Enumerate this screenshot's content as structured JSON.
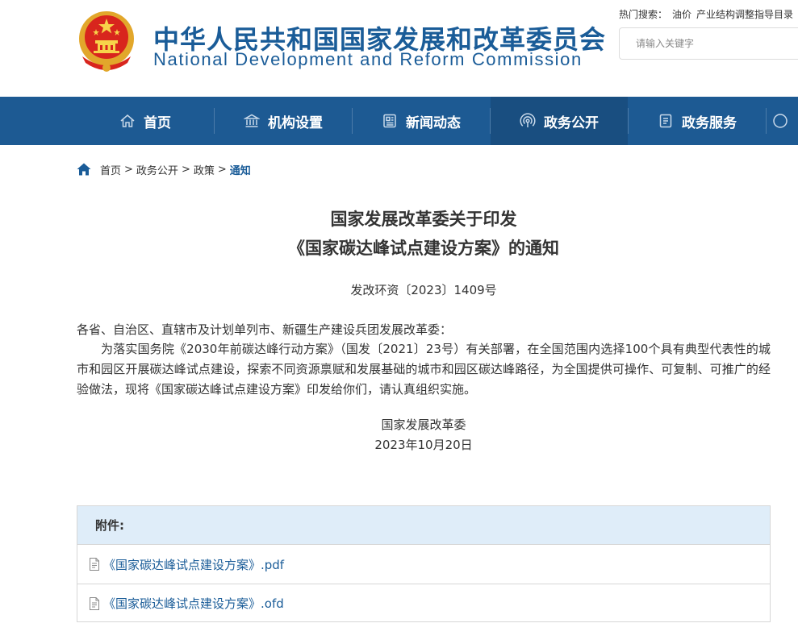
{
  "header": {
    "title_cn": "中华人民共和国国家发展和改革委员会",
    "title_en": "National Development and Reform Commission",
    "hot_search_label": "热门搜索：",
    "hot_search_items": [
      "油价",
      "产业结构调整指导目录"
    ],
    "search_placeholder": "请输入关键字"
  },
  "nav": {
    "items": [
      {
        "label": "首页",
        "icon": "home-icon"
      },
      {
        "label": "机构设置",
        "icon": "institution-icon"
      },
      {
        "label": "新闻动态",
        "icon": "news-icon"
      },
      {
        "label": "政务公开",
        "icon": "broadcast-icon",
        "active": true
      },
      {
        "label": "政务服务",
        "icon": "document-icon"
      }
    ]
  },
  "breadcrumb": {
    "items": [
      "首页",
      "政务公开",
      "政策",
      "通知"
    ],
    "separator": ">"
  },
  "article": {
    "title_line1": "国家发展改革委关于印发",
    "title_line2": "《国家碳达峰试点建设方案》的通知",
    "doc_number": "发改环资〔2023〕1409号",
    "addressee": "各省、自治区、直辖市及计划单列市、新疆生产建设兵团发展改革委：",
    "body": "为落实国务院《2030年前碳达峰行动方案》（国发〔2021〕23号）有关部署，在全国范围内选择100个具有典型代表性的城市和园区开展碳达峰试点建设，探索不同资源禀赋和发展基础的城市和园区碳达峰路径，为全国提供可操作、可复制、可推广的经验做法，现将《国家碳达峰试点建设方案》印发给你们，请认真组织实施。",
    "signature": "国家发展改革委",
    "date": "2023年10月20日"
  },
  "attachments": {
    "header": "附件:",
    "files": [
      {
        "name": "《国家碳达峰试点建设方案》.pdf"
      },
      {
        "name": "《国家碳达峰试点建设方案》.ofd"
      }
    ]
  },
  "colors": {
    "brand_blue": "#1a5c98",
    "nav_bg": "#1d5a93",
    "nav_active": "#194e80",
    "attach_head_bg": "#dfedf9"
  }
}
